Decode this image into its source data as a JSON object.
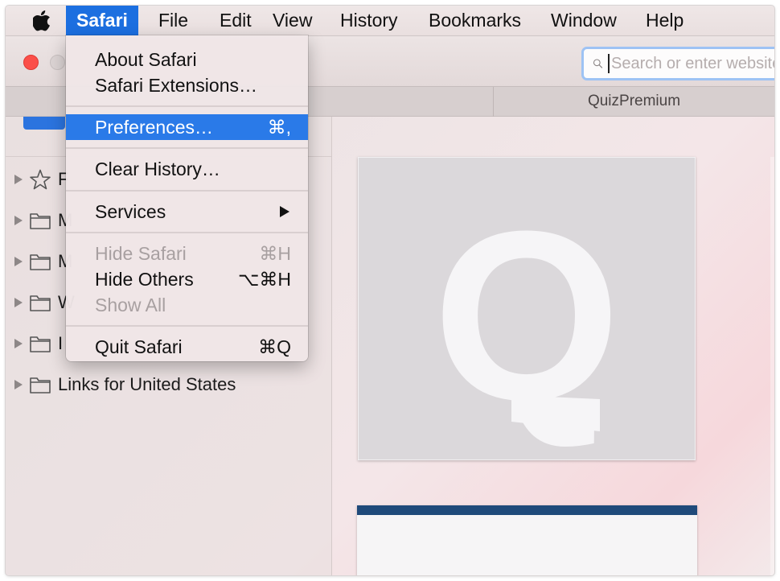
{
  "menubar": {
    "apple_icon": "apple-logo-icon",
    "items": [
      "Safari",
      "File",
      "Edit",
      "View",
      "History",
      "Bookmarks",
      "Window",
      "Help"
    ]
  },
  "toolbar": {
    "search_placeholder": "Search or enter website name"
  },
  "tabs": {
    "active_label": "QuizPremium"
  },
  "sidebar": {
    "items": [
      {
        "label": "F",
        "icon": "star-icon"
      },
      {
        "label": "M",
        "icon": "folder-icon"
      },
      {
        "label": "M",
        "icon": "folder-icon"
      },
      {
        "label": "W",
        "icon": "folder-icon"
      },
      {
        "label": "I",
        "icon": "folder-icon"
      },
      {
        "label": "Links for United States",
        "icon": "folder-icon"
      }
    ]
  },
  "safari_menu": {
    "about": {
      "label": "About Safari"
    },
    "extensions": {
      "label": "Safari Extensions…"
    },
    "preferences": {
      "label": "Preferences…",
      "shortcut": "⌘,"
    },
    "clear_history": {
      "label": "Clear History…"
    },
    "services": {
      "label": "Services"
    },
    "hide_safari": {
      "label": "Hide Safari",
      "shortcut": "⌘H"
    },
    "hide_others": {
      "label": "Hide Others",
      "shortcut": "⌥⌘H"
    },
    "show_all": {
      "label": "Show All"
    },
    "quit": {
      "label": "Quit Safari",
      "shortcut": "⌘Q"
    }
  },
  "top_sites": {
    "tile_letter": "Q"
  },
  "colors": {
    "menu_highlight": "#2a7ae8",
    "close_button": "#fb4f49",
    "tile_banner": "#1f4a7a"
  }
}
